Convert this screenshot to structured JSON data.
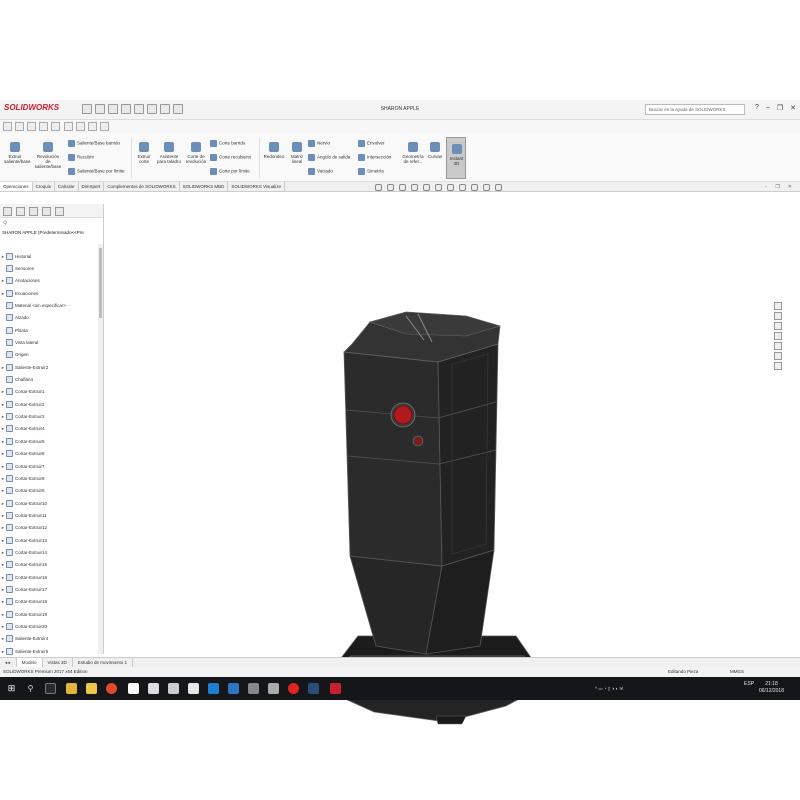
{
  "app": {
    "logo": "SOLIDWORKS",
    "document_title": "SHARON APPLE",
    "search_placeholder": "Buscar en la ayuda de SOLIDWORKS"
  },
  "commands": {
    "extruir_saliente": "Extruir saliente/base",
    "revolucion_saliente": "Revolución de saliente/base",
    "saliente_barrido": "Saliente/Base barrido",
    "recubrir": "Recubrir",
    "saliente_limite": "Saliente/Base por límite",
    "extruir_corte": "Extruir corte",
    "asistente_taladro": "Asistente para taladro",
    "corte_revolucion": "Corte de revolución",
    "corte_barrido": "Corte barrido",
    "corte_recubierto": "Corte recubierto",
    "corte_limite": "Corte por límite",
    "redondeo": "Redondeo",
    "matriz_lineal": "Matriz lineal",
    "nervio": "Nervio",
    "angulo_salida": "Ángulo de salida",
    "vaciado": "Vaciado",
    "envolver": "Envolver",
    "interseccion": "Intersección",
    "simetria": "Simetría",
    "geometria_referencia": "Geometría de refer...",
    "curvas": "Curvas",
    "instant3d": "Instant 3D"
  },
  "tabs": [
    "Operaciones",
    "Croquis",
    "Calcular",
    "DimXpert",
    "Complementos de SOLIDWORKS",
    "SOLIDWORKS MBD",
    "SOLIDWORKS Visualize"
  ],
  "feature_manager": {
    "root": "SHARON APPLE  (Predeterminado<<Pre",
    "items": [
      {
        "label": "Historial",
        "expand": "►"
      },
      {
        "label": "Sensores",
        "expand": ""
      },
      {
        "label": "Anotaciones",
        "expand": "►"
      },
      {
        "label": "Ecuaciones",
        "expand": "►"
      },
      {
        "label": "Material <sin especificar>",
        "expand": ""
      },
      {
        "label": "Alzado",
        "expand": ""
      },
      {
        "label": "Planta",
        "expand": ""
      },
      {
        "label": "Vista lateral",
        "expand": ""
      },
      {
        "label": "Origen",
        "expand": ""
      },
      {
        "label": "Saliente-Extruir2",
        "expand": "►"
      },
      {
        "label": "Chaflán4",
        "expand": ""
      },
      {
        "label": "Cortar-Extruir1",
        "expand": "►"
      },
      {
        "label": "Cortar-Extruir2",
        "expand": "►"
      },
      {
        "label": "Cortar-Extruir3",
        "expand": "►"
      },
      {
        "label": "Cortar-Extruir4",
        "expand": "►"
      },
      {
        "label": "Cortar-Extruir5",
        "expand": "►"
      },
      {
        "label": "Cortar-Extruir6",
        "expand": "►"
      },
      {
        "label": "Cortar-Extruir7",
        "expand": "►"
      },
      {
        "label": "Cortar-Extruir8",
        "expand": "►"
      },
      {
        "label": "Cortar-Extruir9",
        "expand": "►"
      },
      {
        "label": "Cortar-Extruir10",
        "expand": "►"
      },
      {
        "label": "Cortar-Extruir11",
        "expand": "►"
      },
      {
        "label": "Cortar-Extruir12",
        "expand": "►"
      },
      {
        "label": "Cortar-Extruir13",
        "expand": "►"
      },
      {
        "label": "Cortar-Extruir14",
        "expand": "►"
      },
      {
        "label": "Cortar-Extruir15",
        "expand": "►"
      },
      {
        "label": "Cortar-Extruir16",
        "expand": "►"
      },
      {
        "label": "Cortar-Extruir17",
        "expand": "►"
      },
      {
        "label": "Cortar-Extruir18",
        "expand": "►"
      },
      {
        "label": "Cortar-Extruir19",
        "expand": "►"
      },
      {
        "label": "Cortar-Extruir20",
        "expand": "►"
      },
      {
        "label": "Saliente-Extruir4",
        "expand": "►"
      },
      {
        "label": "Saliente-Extruir5",
        "expand": "►"
      }
    ]
  },
  "bottom_tabs": [
    "Modelo",
    "Vistas 3D",
    "Estudio de movimiento 1"
  ],
  "status": {
    "left": "SOLIDWORKS Premium 2017 x64 Edition",
    "editing": "Editando Pieza",
    "units": "MMGS"
  },
  "taskbar": {
    "lang": "ESP",
    "time": "21:18",
    "date": "06/12/2018"
  },
  "colors": {
    "model_body": "#2b2b2b",
    "model_button": "#b01a1f",
    "solidworks_red": "#c8202f"
  }
}
